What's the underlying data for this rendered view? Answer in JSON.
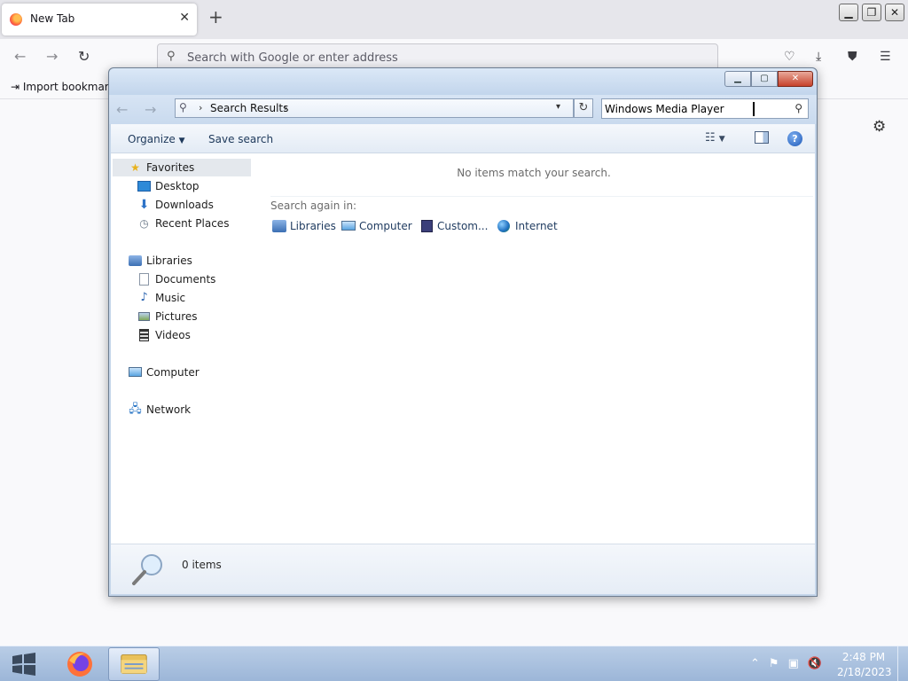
{
  "browser": {
    "tab_title": "New Tab",
    "tab_close": "✕",
    "new_tab": "+",
    "url_placeholder": "Search with Google or enter address",
    "import_bookmarks": "Import bookmarks..."
  },
  "explorer": {
    "address": {
      "breadcrumb": "Search Results"
    },
    "search": {
      "value": "Windows Media Player"
    },
    "toolbar": {
      "organize": "Organize",
      "save_search": "Save search"
    },
    "nav": {
      "favorites": "Favorites",
      "desktop": "Desktop",
      "downloads": "Downloads",
      "recent_places": "Recent Places",
      "libraries": "Libraries",
      "documents": "Documents",
      "music": "Music",
      "pictures": "Pictures",
      "videos": "Videos",
      "computer": "Computer",
      "network": "Network"
    },
    "content": {
      "empty_message": "No items match your search.",
      "search_again_label": "Search again in:",
      "search_again": [
        "Libraries",
        "Computer",
        "Custom...",
        "Internet"
      ]
    },
    "details": {
      "count": "0 items"
    }
  },
  "taskbar": {
    "time": "2:48 PM",
    "date": "2/18/2023"
  },
  "colors": {
    "window_frame": "#c5d6ea",
    "nav_selected": "#e4e8ed",
    "taskbar": "#9cb6d8"
  }
}
